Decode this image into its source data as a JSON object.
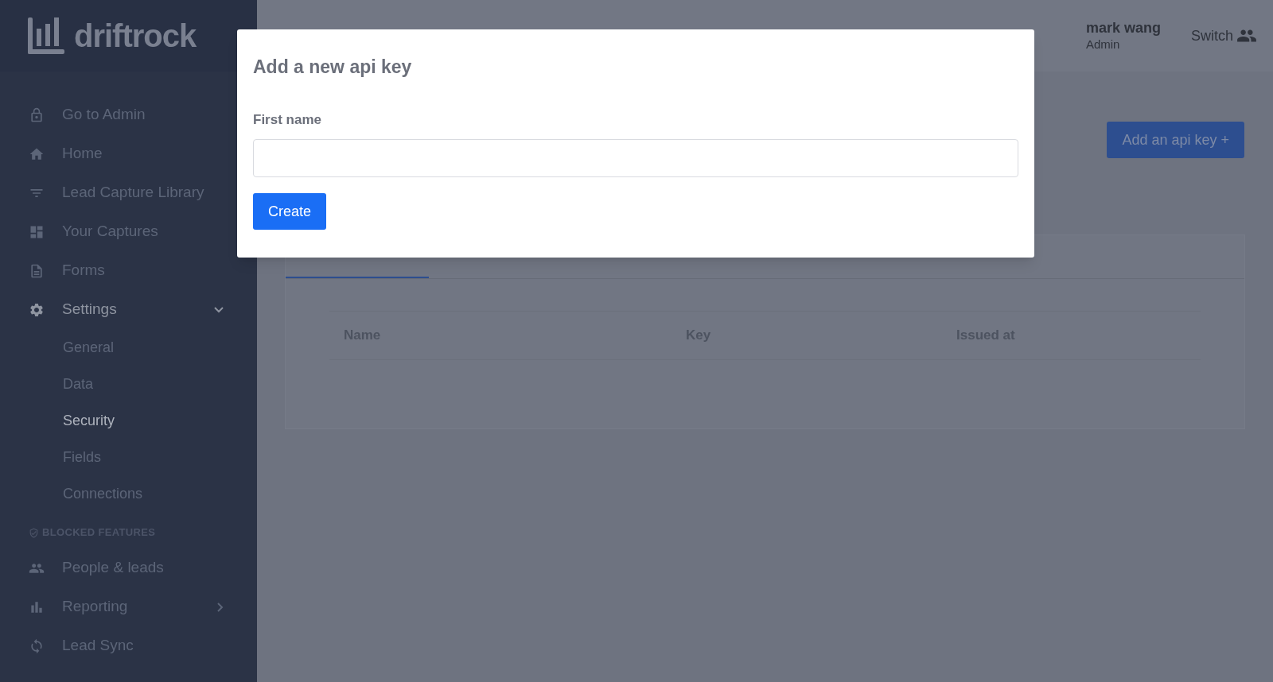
{
  "brand": {
    "name": "driftrock"
  },
  "sidebar": {
    "sections": [
      {
        "items": [
          {
            "label": "Go to Admin",
            "expanded": false,
            "has_submenu": false
          },
          {
            "label": "Home",
            "expanded": false,
            "has_submenu": false
          },
          {
            "label": "Lead Capture Library",
            "expanded": false,
            "has_submenu": false
          },
          {
            "label": "Your Captures",
            "expanded": false,
            "has_submenu": false
          },
          {
            "label": "Forms",
            "expanded": false,
            "has_submenu": false
          },
          {
            "label": "Settings",
            "expanded": true,
            "has_submenu": true,
            "children": [
              {
                "label": "General",
                "selected": false
              },
              {
                "label": "Data",
                "selected": false
              },
              {
                "label": "Security",
                "selected": true
              },
              {
                "label": "Fields",
                "selected": false
              },
              {
                "label": "Connections",
                "selected": false
              }
            ]
          }
        ]
      },
      {
        "title": "BLOCKED FEATURES",
        "items": [
          {
            "label": "People & leads",
            "expanded": false,
            "has_submenu": false
          },
          {
            "label": "Reporting",
            "expanded": false,
            "has_submenu": true
          },
          {
            "label": "Lead Sync",
            "expanded": false,
            "has_submenu": false
          }
        ]
      }
    ]
  },
  "header": {
    "user_name": "mark wang",
    "user_role": "Admin",
    "switch_label": "Switch"
  },
  "page": {
    "add_button": "Add an api key +",
    "table": {
      "columns": [
        "Name",
        "Key",
        "Issued at"
      ]
    }
  },
  "modal": {
    "title": "Add a new api key",
    "field_label": "First name",
    "submit": "Create"
  }
}
